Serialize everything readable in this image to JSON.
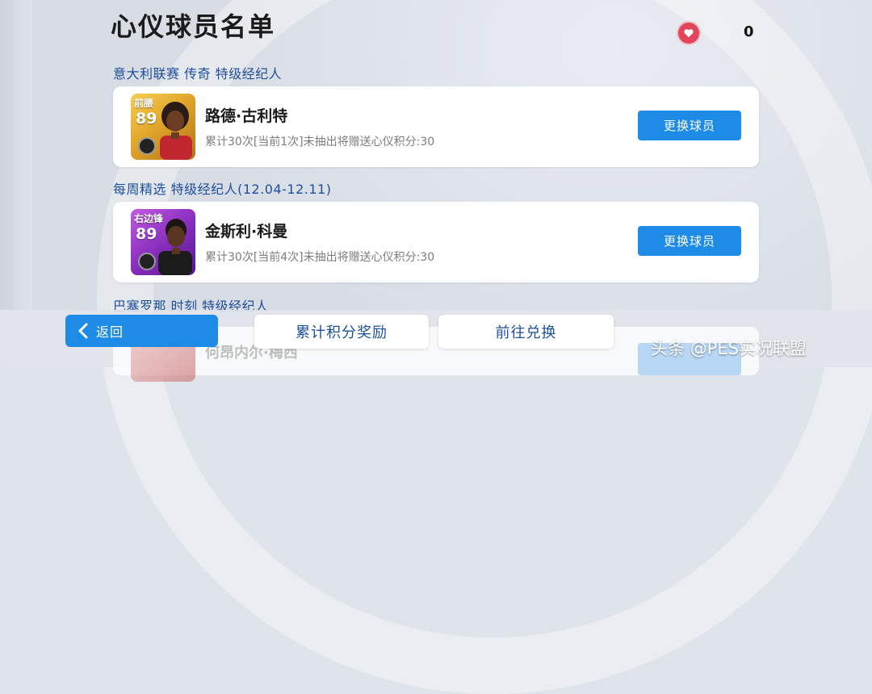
{
  "title": "心仪球员名单",
  "points": {
    "value": "0"
  },
  "sections": [
    {
      "label": "意大利联赛 传奇 特级经纪人",
      "player": {
        "position": "前腰",
        "rating": "89",
        "name": "路德·古利特",
        "desc": "累计30次[当前1次]未抽出将赠送心仪积分:30",
        "button": "更换球员"
      }
    },
    {
      "label": "每周精选 特级经纪人(12.04-12.11)",
      "player": {
        "position": "右边锋",
        "rating": "89",
        "name": "金斯利·科曼",
        "desc": "累计30次[当前4次]未抽出将赠送心仪积分:30",
        "button": "更换球员"
      }
    },
    {
      "label": "巴塞罗那 时刻 特级经纪人",
      "player": {
        "name": "何昂内尔·梅西"
      }
    }
  ],
  "bottom": {
    "back": "返回",
    "rewards": "累计积分奖励",
    "exchange": "前往兑换"
  },
  "watermark": "头条 @PES实况联盟",
  "colors": {
    "accent": "#1e8be6",
    "section_text": "#1d4f9c",
    "heart": "#e0455c"
  }
}
